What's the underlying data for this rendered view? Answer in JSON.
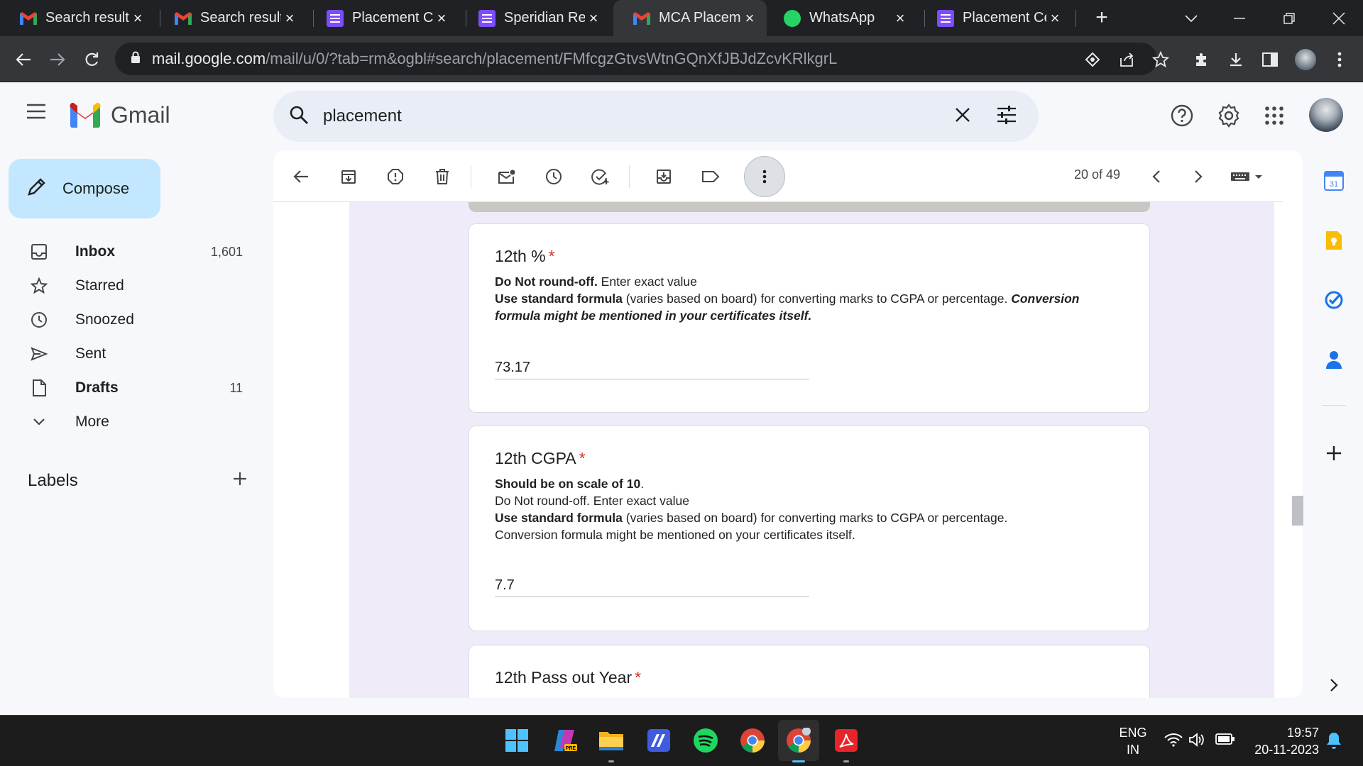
{
  "browser": {
    "tabs": [
      {
        "title": "Search results",
        "favicon": "gmail-icon"
      },
      {
        "title": "Search results",
        "favicon": "gmail-icon"
      },
      {
        "title": "Placement Cel",
        "favicon": "forms-icon"
      },
      {
        "title": "Speridian Reci",
        "favicon": "forms-icon"
      },
      {
        "title": "MCA Placemen",
        "favicon": "gmail-icon",
        "active": true
      },
      {
        "title": "WhatsApp",
        "favicon": "whatsapp-icon"
      },
      {
        "title": "Placement Cel",
        "favicon": "forms-icon"
      }
    ],
    "url_host": "mail.google.com",
    "url_path": "/mail/u/0/?tab=rm&ogbl#search/placement/FMfcgzGtvsWtnGQnXfJBJdZcvKRlkgrL"
  },
  "gmail": {
    "logo_text": "Gmail",
    "search_query": "placement",
    "compose_label": "Compose",
    "nav": [
      {
        "label": "Inbox",
        "count": "1,601",
        "bold": true
      },
      {
        "label": "Starred",
        "count": ""
      },
      {
        "label": "Snoozed",
        "count": ""
      },
      {
        "label": "Sent",
        "count": ""
      },
      {
        "label": "Drafts",
        "count": "11",
        "bold": true
      },
      {
        "label": "More",
        "count": ""
      }
    ],
    "labels_heading": "Labels",
    "pager_text": "20 of 49"
  },
  "form": {
    "q1": {
      "title": "12th %",
      "required": "*",
      "help_b1": "Do Not round-off.",
      "help_t1": " Enter exact value",
      "help_b2": "Use standard formula",
      "help_t2": " (varies based on board) for converting marks to CGPA or percentage. ",
      "help_bi": "Conversion formula might be mentioned in your certificates itself.",
      "answer": "73.17"
    },
    "q2": {
      "title": "12th CGPA",
      "required": "*",
      "help_b1": "Should be on scale of 10",
      "help_t1": ".",
      "help_l2": "Do Not round-off. Enter exact value",
      "help_b3": "Use standard formula",
      "help_t3": " (varies based on board) for converting marks to CGPA or percentage.",
      "help_l4": "Conversion formula might be mentioned on your certificates itself.",
      "answer": "7.7"
    },
    "q3": {
      "title": "12th Pass out Year",
      "required": "*"
    }
  },
  "taskbar": {
    "lang_line1": "ENG",
    "lang_line2": "IN",
    "time": "19:57",
    "date": "20-11-2023"
  },
  "colors": {
    "accent_compose": "#c2e7ff",
    "search_bg": "#e9eef6",
    "form_bg": "#f0ebf8",
    "required_red": "#d93025"
  }
}
